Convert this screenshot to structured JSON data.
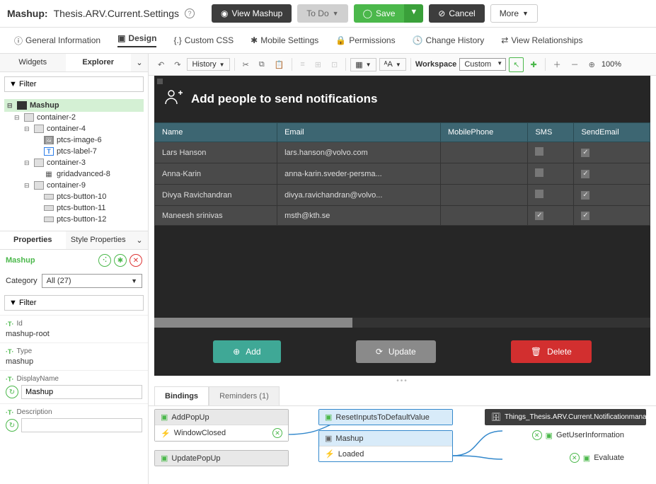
{
  "header": {
    "prefix": "Mashup:",
    "name": "Thesis.ARV.Current.Settings",
    "view_btn": "View Mashup",
    "todo_btn": "To Do",
    "save_btn": "Save",
    "cancel_btn": "Cancel",
    "more_btn": "More"
  },
  "main_tabs": [
    "General Information",
    "Design",
    "Custom CSS",
    "Mobile Settings",
    "Permissions",
    "Change History",
    "View Relationships"
  ],
  "main_tab_active": 1,
  "side_tabs": {
    "widgets": "Widgets",
    "explorer": "Explorer"
  },
  "filter_placeholder": "Filter",
  "tree": {
    "root": "Mashup",
    "nodes": [
      {
        "l": "container-2",
        "i": 1,
        "t": "c"
      },
      {
        "l": "container-4",
        "i": 2,
        "t": "c"
      },
      {
        "l": "ptcs-image-6",
        "i": 3,
        "t": "img"
      },
      {
        "l": "ptcs-label-7",
        "i": 3,
        "t": "lbl"
      },
      {
        "l": "container-3",
        "i": 2,
        "t": "c"
      },
      {
        "l": "gridadvanced-8",
        "i": 3,
        "t": "grid"
      },
      {
        "l": "container-9",
        "i": 2,
        "t": "c"
      },
      {
        "l": "ptcs-button-10",
        "i": 3,
        "t": "btn"
      },
      {
        "l": "ptcs-button-11",
        "i": 3,
        "t": "btn"
      },
      {
        "l": "ptcs-button-12",
        "i": 3,
        "t": "btn"
      }
    ]
  },
  "prop_tabs": {
    "properties": "Properties",
    "style": "Style Properties"
  },
  "prop_name": "Mashup",
  "category_label": "Category",
  "category_value": "All (27)",
  "props": [
    {
      "label": "Id",
      "value": "mashup-root",
      "text": true
    },
    {
      "label": "Type",
      "value": "mashup",
      "text": true
    },
    {
      "label": "DisplayName",
      "value": "Mashup",
      "input": true
    },
    {
      "label": "Description",
      "value": "",
      "input": true
    }
  ],
  "toolbar": {
    "history": "History",
    "workspace_label": "Workspace",
    "workspace_value": "Custom",
    "zoom": "100%"
  },
  "canvas": {
    "title": "Add people to send notifications",
    "columns": [
      "Name",
      "Email",
      "MobilePhone",
      "SMS",
      "SendEmail"
    ],
    "rows": [
      {
        "name": "Lars Hanson",
        "email": "lars.hanson@volvo.com",
        "phone": "",
        "sms": false,
        "send": true
      },
      {
        "name": "Anna-Karin",
        "email": "anna-karin.sveder-persma...",
        "phone": "",
        "sms": false,
        "send": true
      },
      {
        "name": "Divya Ravichandran",
        "email": "divya.ravichandran@volvo...",
        "phone": "",
        "sms": false,
        "send": true
      },
      {
        "name": "Maneesh srinivas",
        "email": "msth@kth.se",
        "phone": "",
        "sms": true,
        "send": true
      }
    ],
    "add_btn": "Add",
    "update_btn": "Update",
    "delete_btn": "Delete"
  },
  "sub_tabs": {
    "bindings": "Bindings",
    "reminders": "Reminders (1)"
  },
  "bindings": {
    "addpopup": "AddPopUp",
    "windowclosed": "WindowClosed",
    "updatepopup": "UpdatePopUp",
    "reset": "ResetInputsToDefaultValue",
    "mashup": "Mashup",
    "loaded": "Loaded",
    "datasource": "Things_Thesis.ARV.Current.Notificationmanager",
    "getuser": "GetUserInformation",
    "evaluate": "Evaluate"
  }
}
